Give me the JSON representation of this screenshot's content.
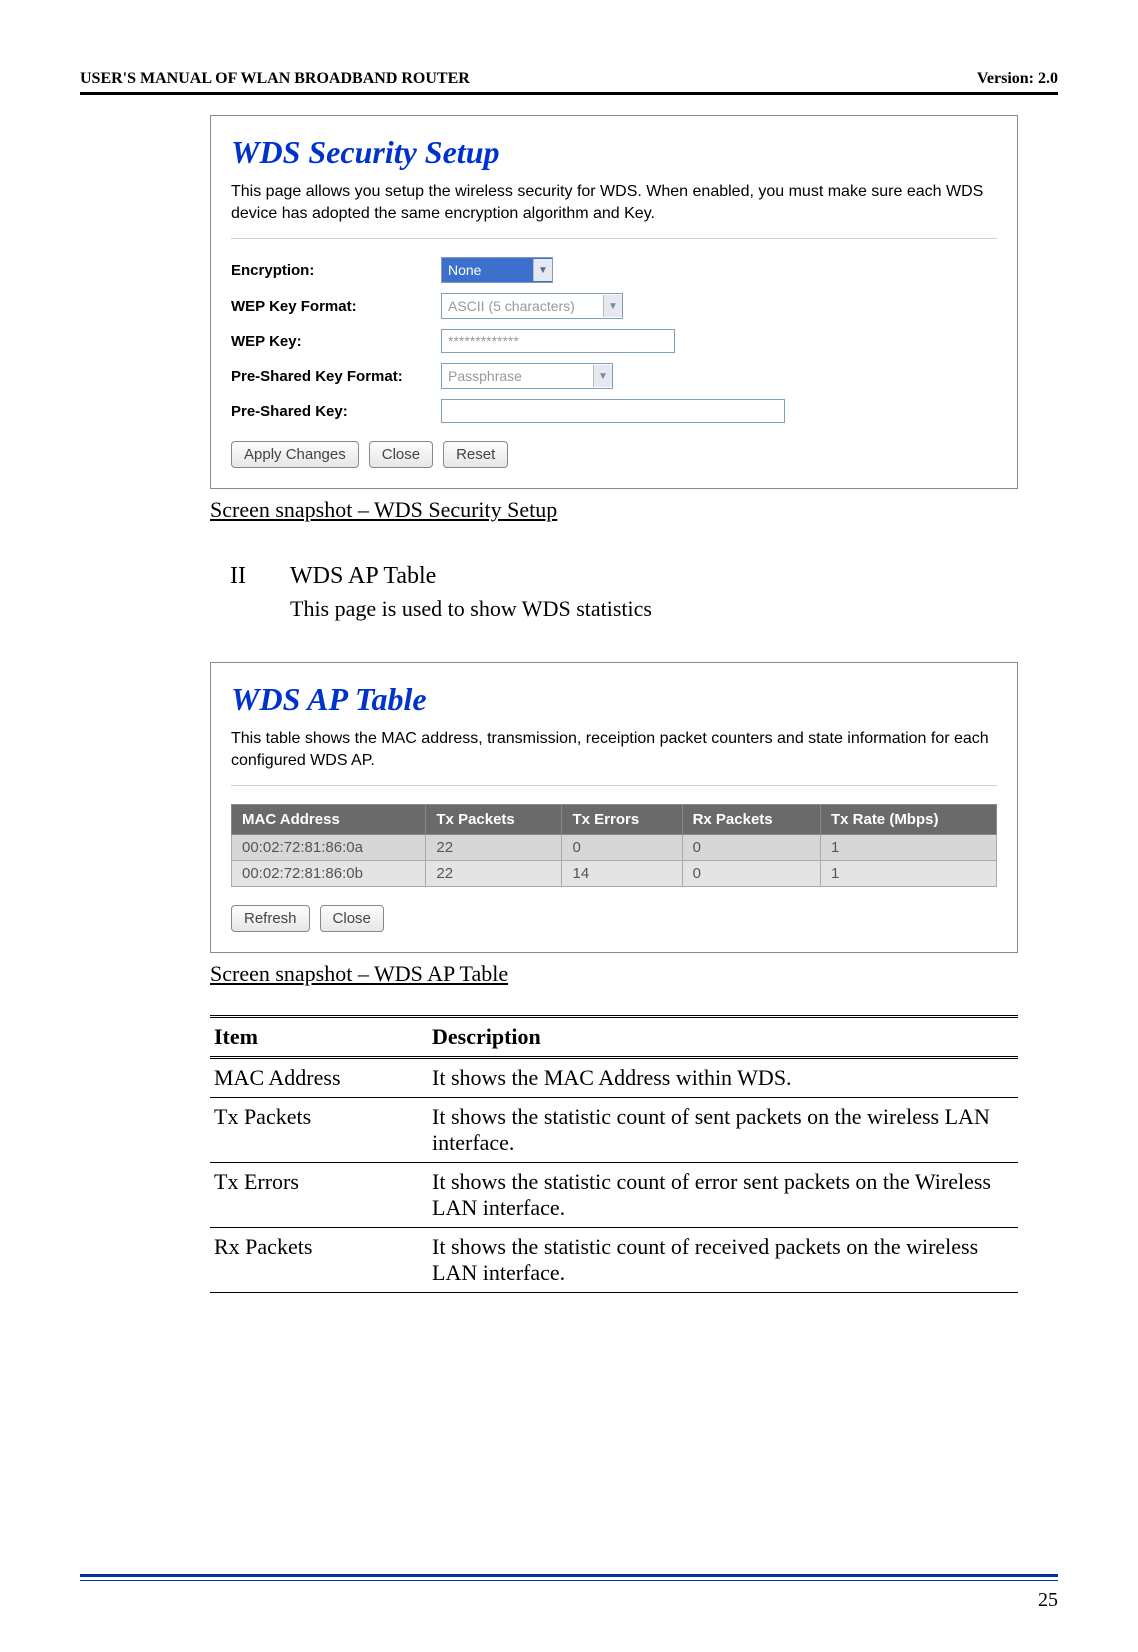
{
  "header": {
    "left": "USER'S MANUAL OF WLAN BROADBAND ROUTER",
    "right": "Version: 2.0"
  },
  "panel1": {
    "title": "WDS Security Setup",
    "desc": "This page allows you setup the wireless security for WDS. When enabled, you must make sure each WDS device has adopted the same encryption algorithm and Key.",
    "labels": {
      "encryption": "Encryption:",
      "wep_format": "WEP Key Format:",
      "wep_key": "WEP Key:",
      "psk_format": "Pre-Shared Key Format:",
      "psk": "Pre-Shared Key:"
    },
    "values": {
      "encryption": "None",
      "wep_format": "ASCII (5 characters)",
      "wep_key": "*************",
      "psk_format": "Passphrase",
      "psk": ""
    },
    "buttons": {
      "apply": "Apply Changes",
      "close": "Close",
      "reset": "Reset"
    }
  },
  "caption1": "Screen snapshot – WDS Security Setup",
  "section2": {
    "num": "II",
    "title": "WDS AP Table",
    "desc": "This page is used to show WDS statistics"
  },
  "panel2": {
    "title": "WDS AP Table",
    "desc": "This table shows the MAC address, transmission, receiption packet counters and state information for each configured WDS AP.",
    "headers": {
      "mac": "MAC Address",
      "txp": "Tx Packets",
      "txe": "Tx Errors",
      "rxp": "Rx Packets",
      "rate": "Tx Rate (Mbps)"
    },
    "buttons": {
      "refresh": "Refresh",
      "close": "Close"
    }
  },
  "chart_data": {
    "type": "table",
    "title": "WDS AP Table",
    "columns": [
      "MAC Address",
      "Tx Packets",
      "Tx Errors",
      "Rx Packets",
      "Tx Rate (Mbps)"
    ],
    "rows": [
      {
        "mac": "00:02:72:81:86:0a",
        "txp": "22",
        "txe": "0",
        "rxp": "0",
        "rate": "1"
      },
      {
        "mac": "00:02:72:81:86:0b",
        "txp": "22",
        "txe": "14",
        "rxp": "0",
        "rate": "1"
      }
    ]
  },
  "caption2": "Screen snapshot – WDS AP Table",
  "desc_table": {
    "head_item": "Item",
    "head_desc": "Description",
    "rows": [
      {
        "item": "MAC Address",
        "desc": "It shows the MAC Address within WDS."
      },
      {
        "item": "Tx Packets",
        "desc": "It shows the statistic count of sent packets on the wireless LAN interface."
      },
      {
        "item": "Tx Errors",
        "desc": "It shows the statistic count of error sent packets on the Wireless LAN interface."
      },
      {
        "item": "Rx Packets",
        "desc": "It shows the statistic count of received packets on the wireless LAN interface."
      }
    ]
  },
  "page_number": "25"
}
